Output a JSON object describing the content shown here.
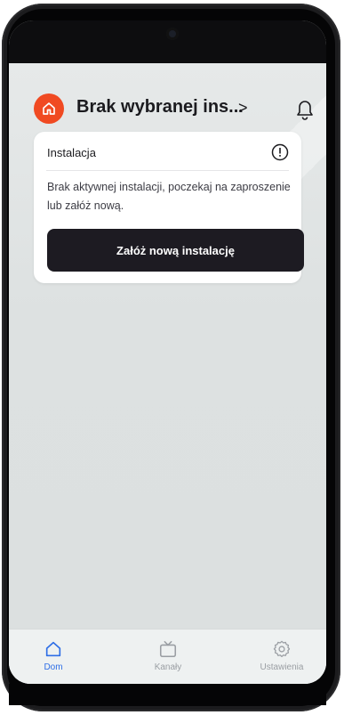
{
  "header": {
    "title": "Brak wybranej ins...",
    "chevron": ">",
    "home_icon": "home-icon",
    "bell_icon": "bell-icon"
  },
  "card": {
    "title": "Instalacja",
    "info_icon": "alert-circle-icon",
    "message": "Brak aktywnej instalacji, poczekaj na zaproszenie lub załóż nową.",
    "button_label": "Załóż nową instalację"
  },
  "tabs": [
    {
      "label": "Dom",
      "icon": "home-icon",
      "active": true
    },
    {
      "label": "Kanały",
      "icon": "tv-icon",
      "active": false
    },
    {
      "label": "Ustawienia",
      "icon": "gear-icon",
      "active": false
    }
  ],
  "colors": {
    "accent": "#2e6ee6",
    "brand": "#f04a22",
    "button": "#1d1b22"
  }
}
